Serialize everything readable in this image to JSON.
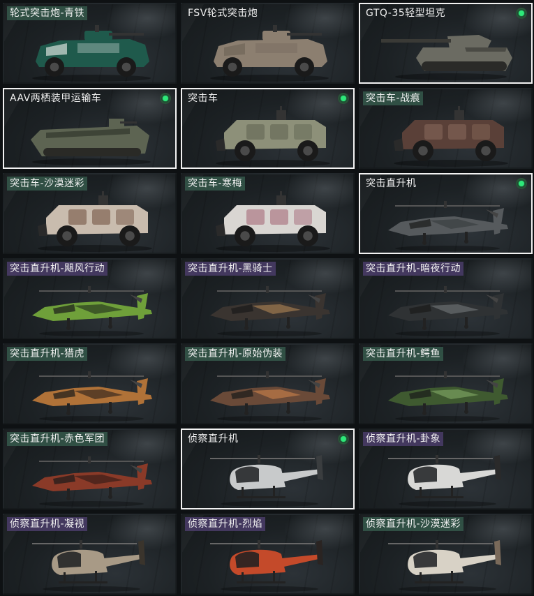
{
  "cards": [
    {
      "label": "轮式突击炮-青铁",
      "kind": "wheeled-gun",
      "color": "#1f5a4c",
      "accent": "#d7e0dc",
      "tag": "green",
      "owned": false,
      "selected": false
    },
    {
      "label": "FSV轮式突击炮",
      "kind": "wheeled-gun",
      "color": "#8c7f70",
      "accent": "#6f6558",
      "tag": "none",
      "owned": false,
      "selected": false
    },
    {
      "label": "GTQ-35轻型坦克",
      "kind": "tank",
      "color": "#6b6b62",
      "accent": "#4a4a44",
      "tag": "none",
      "owned": true,
      "selected": true
    },
    {
      "label": "AAV两栖装甲运输车",
      "kind": "amphibious",
      "color": "#5d6452",
      "accent": "#3e4437",
      "tag": "none",
      "owned": true,
      "selected": true
    },
    {
      "label": "突击车",
      "kind": "assault-car",
      "color": "#8d9079",
      "accent": "#5e6150",
      "tag": "none",
      "owned": true,
      "selected": true
    },
    {
      "label": "突击车-战痕",
      "kind": "assault-car",
      "color": "#5a4038",
      "accent": "#8a6a5c",
      "tag": "green",
      "owned": false,
      "selected": false
    },
    {
      "label": "突击车-沙漠迷彩",
      "kind": "assault-car",
      "color": "#c9bcae",
      "accent": "#6b4a3a",
      "tag": "green",
      "owned": false,
      "selected": false
    },
    {
      "label": "突击车-寒梅",
      "kind": "assault-car",
      "color": "#d9d6d2",
      "accent": "#a06070",
      "tag": "green",
      "owned": false,
      "selected": false
    },
    {
      "label": "突击直升机",
      "kind": "attack-heli",
      "color": "#565a5d",
      "accent": "#3a3e41",
      "tag": "none",
      "owned": true,
      "selected": true
    },
    {
      "label": "突击直升机-飓风行动",
      "kind": "attack-heli",
      "color": "#6fa03a",
      "accent": "#2a3a20",
      "tag": "purple",
      "owned": false,
      "selected": false
    },
    {
      "label": "突击直升机-黑骑士",
      "kind": "attack-heli",
      "color": "#3a3430",
      "accent": "#a07a50",
      "tag": "purple",
      "owned": false,
      "selected": false
    },
    {
      "label": "突击直升机-暗夜行动",
      "kind": "attack-heli",
      "color": "#2f3234",
      "accent": "#6a6e70",
      "tag": "purple",
      "owned": false,
      "selected": false
    },
    {
      "label": "突击直升机-猎虎",
      "kind": "attack-heli",
      "color": "#b07238",
      "accent": "#3a2a20",
      "tag": "green",
      "owned": false,
      "selected": false
    },
    {
      "label": "突击直升机-原始伪装",
      "kind": "attack-heli",
      "color": "#6a4a38",
      "accent": "#c07a48",
      "tag": "green",
      "owned": false,
      "selected": false
    },
    {
      "label": "突击直升机-鳄鱼",
      "kind": "attack-heli",
      "color": "#3f5a30",
      "accent": "#7aa060",
      "tag": "green",
      "owned": false,
      "selected": false
    },
    {
      "label": "突击直升机-赤色军团",
      "kind": "attack-heli",
      "color": "#8a3a28",
      "accent": "#3a1e18",
      "tag": "green",
      "owned": false,
      "selected": false
    },
    {
      "label": "侦察直升机",
      "kind": "scout-heli",
      "color": "#c8cacb",
      "accent": "#3a3d3f",
      "tag": "none",
      "owned": true,
      "selected": true
    },
    {
      "label": "侦察直升机-卦象",
      "kind": "scout-heli",
      "color": "#d8d8d6",
      "accent": "#2a2a2a",
      "tag": "purple",
      "owned": false,
      "selected": false
    },
    {
      "label": "侦察直升机-凝视",
      "kind": "scout-heli",
      "color": "#a89a86",
      "accent": "#3a342c",
      "tag": "purple",
      "owned": false,
      "selected": false
    },
    {
      "label": "侦察直升机-烈焰",
      "kind": "scout-heli",
      "color": "#c44a2a",
      "accent": "#2a2422",
      "tag": "purple",
      "owned": false,
      "selected": false
    },
    {
      "label": "侦察直升机-沙漠迷彩",
      "kind": "scout-heli",
      "color": "#d8d2c6",
      "accent": "#7a6a5a",
      "tag": "green",
      "owned": false,
      "selected": false
    }
  ]
}
